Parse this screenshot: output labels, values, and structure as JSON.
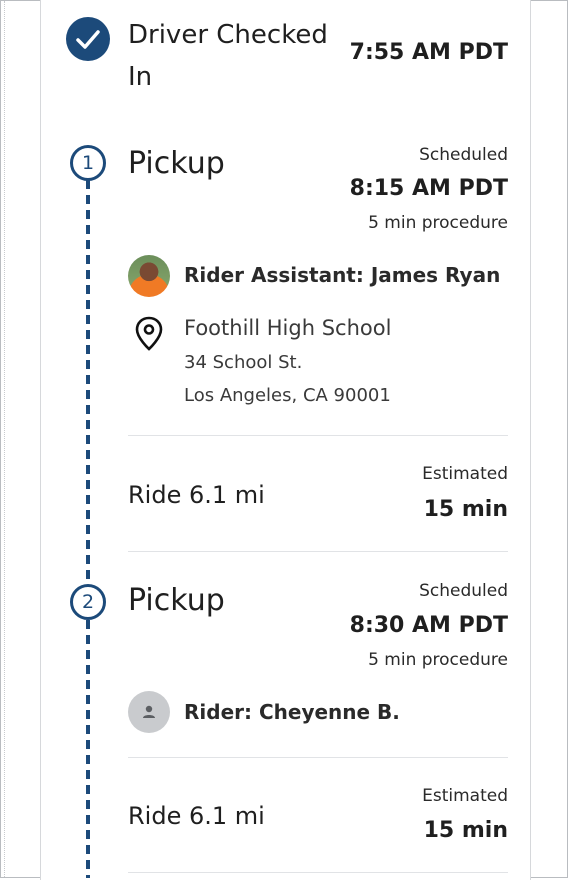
{
  "checked_in": {
    "title": "Driver Checked",
    "title_line2": "In",
    "time": "7:55 AM PDT",
    "icon": "check-icon"
  },
  "stops": [
    {
      "number": "1",
      "title": "Pickup",
      "status": "Scheduled",
      "time": "8:15 AM PDT",
      "procedure": "5 min procedure",
      "person_label": "Rider Assistant: James Ryan",
      "location": {
        "name": "Foothill High School",
        "street": "34 School St.",
        "city": "Los Angeles, CA 90001",
        "icon": "map-pin-icon"
      }
    },
    {
      "number": "2",
      "title": "Pickup",
      "status": "Scheduled",
      "time": "8:30 AM PDT",
      "procedure": "5 min procedure",
      "person_label": "Rider: Cheyenne B."
    }
  ],
  "rides": [
    {
      "distance": "Ride 6.1 mi",
      "label": "Estimated",
      "duration": "15 min"
    },
    {
      "distance": "Ride 6.1 mi",
      "label": "Estimated",
      "duration": "15 min"
    }
  ],
  "colors": {
    "accent": "#1c4a7a",
    "divider": "#e1e3e6"
  }
}
